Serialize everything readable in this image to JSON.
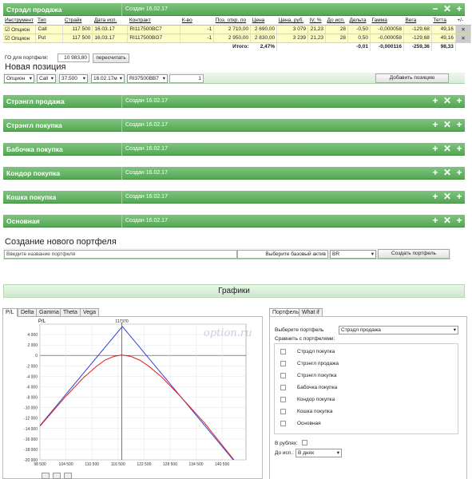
{
  "portfolio": {
    "title": "Стрэдл продажа",
    "created": "Создан 16.02.17"
  },
  "table": {
    "headers": [
      "Инструмент",
      "Тип",
      "Страйк",
      "Дата исп.",
      "Контракт",
      "К-во",
      "Поз. откр. по",
      "Цена",
      "Цена, руб.",
      "IV, %",
      "До исп.",
      "Дельта",
      "Гамма",
      "Вега",
      "Тетта"
    ],
    "rows": [
      [
        "Опцион",
        "Call",
        "117 500",
        "16.03.17",
        "RI117500BC7",
        "-1",
        "2 710,00",
        "2 690,00",
        "3 079",
        "21,23",
        "28",
        "-0,50",
        "-0,000058",
        "-129,68",
        "49,16"
      ],
      [
        "Опцион",
        "Put",
        "117 500",
        "16.03.17",
        "RI117500BO7",
        "-1",
        "2 950,00",
        "2 830,00",
        "3 239",
        "21,23",
        "28",
        "0,50",
        "-0,000058",
        "-129,68",
        "49,16"
      ]
    ],
    "total_label": "Итого:",
    "total_pct": "2,47%",
    "total_delta": "-0,01",
    "total_gamma": "-0,000116",
    "total_vega": "-259,36",
    "total_theta": "98,33",
    "plusminus": "+/-"
  },
  "go": {
    "label": "ГО для портфеля:",
    "value": "10 983,80",
    "recalc": "пересчитать"
  },
  "new_position": {
    "title": "Новая позиция",
    "instrument": "Опцион",
    "type": "Call",
    "strike": "37.500",
    "date": "16.02.17м",
    "contract": "RI37500BB7",
    "qty": "1",
    "add": "Добавить позицию"
  },
  "portfolios": [
    {
      "title": "Стрэнгл продажа",
      "created": "Создан 16.02.17"
    },
    {
      "title": "Стрэнгл покупка",
      "created": "Создан 16.02.17"
    },
    {
      "title": "Бабочка покупка",
      "created": "Создан 16.02.17"
    },
    {
      "title": "Кондор покупка",
      "created": "Создан 16.02.17"
    },
    {
      "title": "Кошка покупка",
      "created": "Создан 16.02.17"
    },
    {
      "title": "Основная",
      "created": "Создан 16.02.17"
    }
  ],
  "create": {
    "title": "Создание нового портфеля",
    "name_placeholder": "Введите название портфеля",
    "base_label": "Выберите базовый актив",
    "base_value": "BR",
    "button": "Создать портфель"
  },
  "graphs": {
    "title": "Графики",
    "tabs": [
      "P/L",
      "Delta",
      "Gamma",
      "Theta",
      "Vega"
    ],
    "watermark": "option.ru"
  },
  "side": {
    "tabs": [
      "Портфель",
      "What if"
    ],
    "choose_label": "Выберите портфель",
    "choose_value": "Стрэдл продажа",
    "compare_label": "Сравнить с портфелями:",
    "compare": [
      "Стрэдл покупка",
      "Стрэнгл продажа",
      "Стрэнгл покупка",
      "Бабочка покупка",
      "Кондор покупка",
      "Кошка покупка",
      "Основная"
    ],
    "rub_label": "В рублях:",
    "exp_label": "До исп.:",
    "exp_value": "В днях"
  },
  "chart_data": {
    "type": "line",
    "ylabel": "P/L",
    "marker_label": "117370",
    "marker_x": 117370,
    "xlim": [
      98500,
      146000
    ],
    "ylim": [
      -20000,
      6000
    ],
    "xticks": [
      98500,
      104500,
      110500,
      116500,
      122500,
      128500,
      134500,
      140500
    ],
    "xtick_labels": [
      "98 500",
      "104 500",
      "110 500",
      "116 500",
      "122 500",
      "128 500",
      "134 500",
      "140 500"
    ],
    "yticks": [
      6000,
      4000,
      2000,
      0,
      -2000,
      -4000,
      -6000,
      -8000,
      -10000,
      -12000,
      -14000,
      -16000,
      -18000,
      -20000
    ],
    "ytick_labels": [
      "",
      "4 000",
      "2 000",
      "0",
      "-2 000",
      "-4 000",
      "-6 000",
      "-8 000",
      "-10 000",
      "-12 000",
      "-14 000",
      "-16 000",
      "-18 000",
      "-20 000"
    ],
    "series": [
      {
        "color": "#3344dd",
        "x": [
          98500,
          117500,
          146000
        ],
        "y": [
          -13440,
          5560,
          -22940
        ]
      },
      {
        "color": "#dd2222",
        "x": [
          98500,
          104500,
          108500,
          111500,
          113500,
          115500,
          117370,
          119500,
          121500,
          123500,
          126500,
          130500,
          136500,
          146000
        ],
        "y": [
          -13540,
          -7800,
          -4300,
          -2100,
          -900,
          -200,
          100,
          -200,
          -900,
          -2000,
          -4100,
          -7500,
          -13000,
          -22900
        ]
      }
    ]
  }
}
